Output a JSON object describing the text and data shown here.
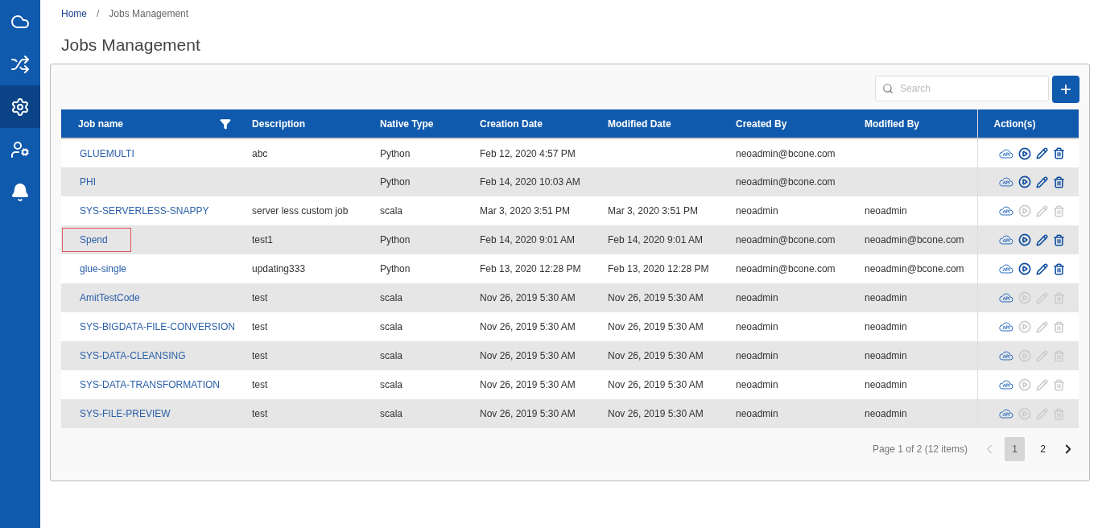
{
  "sidebar": {
    "items": [
      {
        "kind": "cloud",
        "selected": false
      },
      {
        "kind": "shuffle",
        "selected": false
      },
      {
        "kind": "gears",
        "selected": true
      },
      {
        "kind": "user-lock",
        "selected": false
      },
      {
        "kind": "bell",
        "selected": false
      }
    ]
  },
  "breadcrumb": [
    "Home",
    "Jobs Management"
  ],
  "breadcrumb_separator": "/",
  "title": "Jobs Management",
  "search": {
    "placeholder": "Search"
  },
  "add_button": "+",
  "table": {
    "columns": [
      {
        "label": "Job name",
        "filter": true
      },
      {
        "label": "Description",
        "filter": false
      },
      {
        "label": "Native Type",
        "filter": false
      },
      {
        "label": "Creation Date",
        "filter": false
      },
      {
        "label": "Modified Date",
        "filter": false
      },
      {
        "label": "Created By",
        "filter": false
      },
      {
        "label": "Modified By",
        "filter": false
      },
      {
        "label": "Action(s)",
        "filter": false
      }
    ],
    "rows": [
      {
        "name": "GLUEMULTI",
        "description": "abc",
        "native_type": "Python",
        "creation_date": "Feb 12, 2020 4:57 PM",
        "modified_date": "",
        "created_by": "neoadmin@bcone.com",
        "modified_by": "",
        "actions_enabled": true,
        "focused": false
      },
      {
        "name": "PHI",
        "description": "",
        "native_type": "Python",
        "creation_date": "Feb 14, 2020 10:03 AM",
        "modified_date": "",
        "created_by": "neoadmin@bcone.com",
        "modified_by": "",
        "actions_enabled": true,
        "focused": false
      },
      {
        "name": "SYS-SERVERLESS-SNAPPY",
        "description": "server less custom job",
        "native_type": "scala",
        "creation_date": "Mar 3, 2020 3:51 PM",
        "modified_date": "Mar 3, 2020 3:51 PM",
        "created_by": "neoadmin",
        "modified_by": "neoadmin",
        "actions_enabled": false,
        "focused": false
      },
      {
        "name": "Spend",
        "description": "test1",
        "native_type": "Python",
        "creation_date": "Feb 14, 2020 9:01 AM",
        "modified_date": "Feb 14, 2020 9:01 AM",
        "created_by": "neoadmin@bcone.com",
        "modified_by": "neoadmin@bcone.com",
        "actions_enabled": true,
        "focused": true
      },
      {
        "name": "glue-single",
        "description": "updating333",
        "native_type": "Python",
        "creation_date": "Feb 13, 2020 12:28 PM",
        "modified_date": "Feb 13, 2020 12:28 PM",
        "created_by": "neoadmin@bcone.com",
        "modified_by": "neoadmin@bcone.com",
        "actions_enabled": true,
        "focused": false
      },
      {
        "name": "AmitTestCode",
        "description": "test",
        "native_type": "scala",
        "creation_date": "Nov 26, 2019 5:30 AM",
        "modified_date": "Nov 26, 2019 5:30 AM",
        "created_by": "neoadmin",
        "modified_by": "neoadmin",
        "actions_enabled": false,
        "focused": false
      },
      {
        "name": "SYS-BIGDATA-FILE-CONVERSION",
        "description": "test",
        "native_type": "scala",
        "creation_date": "Nov 26, 2019 5:30 AM",
        "modified_date": "Nov 26, 2019 5:30 AM",
        "created_by": "neoadmin",
        "modified_by": "neoadmin",
        "actions_enabled": false,
        "focused": false
      },
      {
        "name": "SYS-DATA-CLEANSING",
        "description": "test",
        "native_type": "scala",
        "creation_date": "Nov 26, 2019 5:30 AM",
        "modified_date": "Nov 26, 2019 5:30 AM",
        "created_by": "neoadmin",
        "modified_by": "neoadmin",
        "actions_enabled": false,
        "focused": false
      },
      {
        "name": "SYS-DATA-TRANSFORMATION",
        "description": "test",
        "native_type": "scala",
        "creation_date": "Nov 26, 2019 5:30 AM",
        "modified_date": "Nov 26, 2019 5:30 AM",
        "created_by": "neoadmin",
        "modified_by": "neoadmin",
        "actions_enabled": false,
        "focused": false
      },
      {
        "name": "SYS-FILE-PREVIEW",
        "description": "test",
        "native_type": "scala",
        "creation_date": "Nov 26, 2019 5:30 AM",
        "modified_date": "Nov 26, 2019 5:30 AM",
        "created_by": "neoadmin",
        "modified_by": "neoadmin",
        "actions_enabled": false,
        "focused": false
      }
    ]
  },
  "pagination": {
    "summary": "Page 1 of 2 (12 items)",
    "prev_disabled": true,
    "pages": [
      {
        "label": "1",
        "selected": true
      },
      {
        "label": "2",
        "selected": false
      }
    ]
  }
}
